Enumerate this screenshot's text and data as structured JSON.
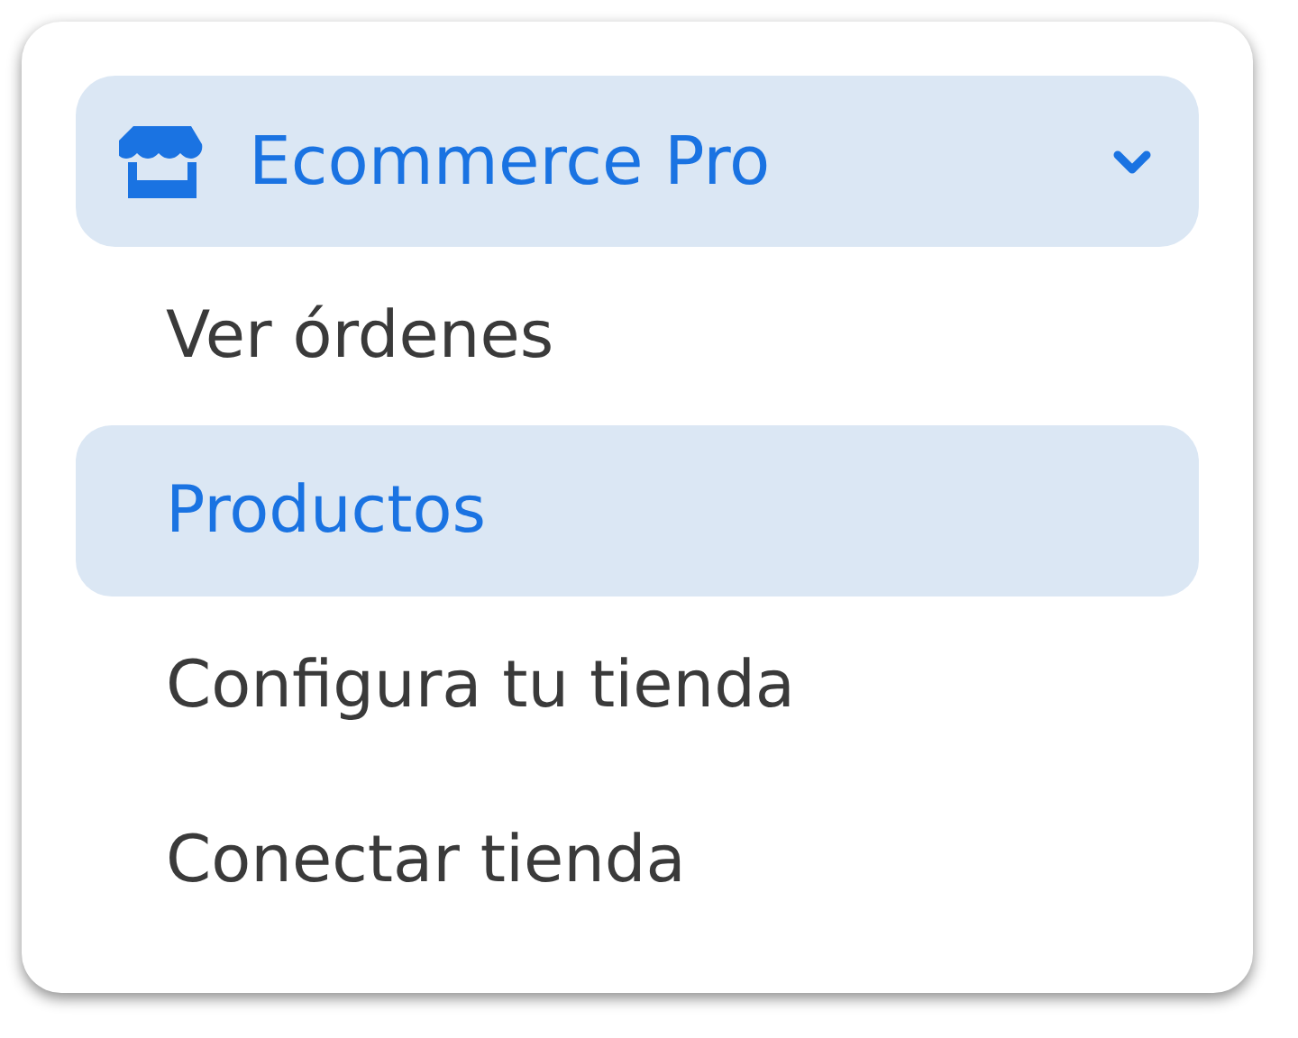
{
  "menu": {
    "title": "Ecommerce Pro",
    "expanded": true,
    "items": [
      {
        "label": "Ver órdenes",
        "selected": false
      },
      {
        "label": "Productos",
        "selected": true
      },
      {
        "label": "Configura tu tienda",
        "selected": false
      },
      {
        "label": "Conectar tienda",
        "selected": false
      }
    ]
  }
}
